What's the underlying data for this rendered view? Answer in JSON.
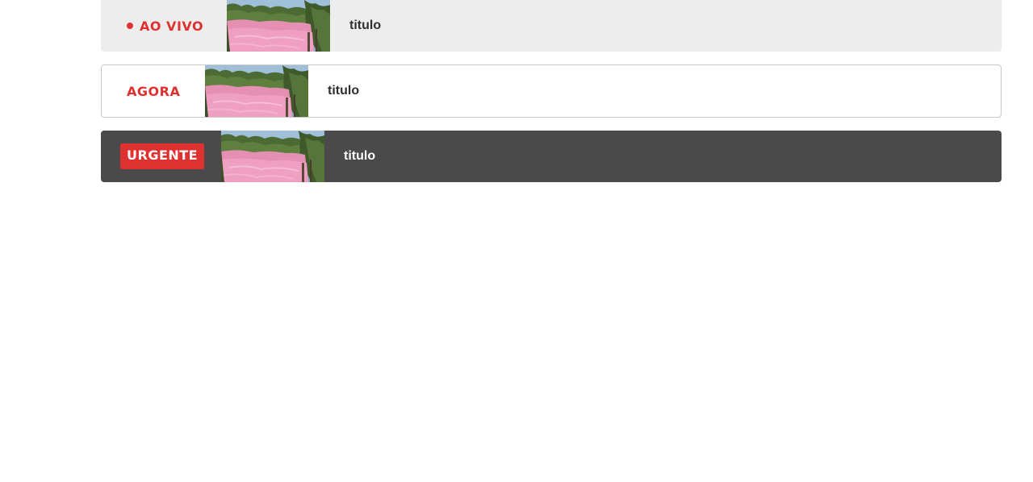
{
  "banners": [
    {
      "variant": "live",
      "tag_label": "AO VIVO",
      "tag_icon": "live-dot-icon",
      "thumbnail": "pink-lagoon-mangrove-photo",
      "title": "titulo"
    },
    {
      "variant": "now",
      "tag_label": "AGORA",
      "thumbnail": "pink-lagoon-mangrove-photo",
      "title": "titulo"
    },
    {
      "variant": "urgent",
      "tag_label": "URGENTE",
      "thumbnail": "pink-lagoon-mangrove-photo",
      "title": "titulo"
    }
  ],
  "colors": {
    "accent_red": "#e03131",
    "live_background": "#ededed",
    "now_background": "#ffffff",
    "now_border": "#c8c8c8",
    "urgent_background": "#4a4a4a",
    "title_dark": "#2f2f2f",
    "title_light": "#ffffff"
  }
}
